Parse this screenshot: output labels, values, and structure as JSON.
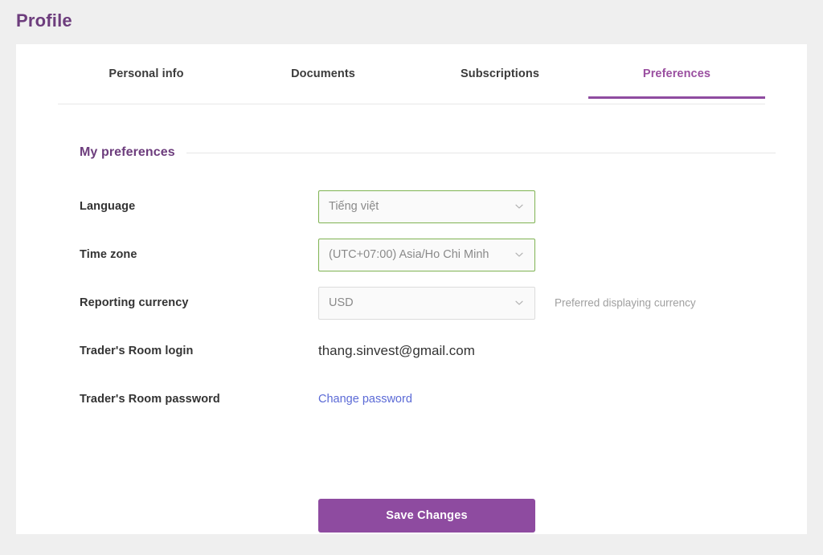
{
  "page": {
    "title": "Profile"
  },
  "tabs": [
    {
      "label": "Personal info",
      "active": false
    },
    {
      "label": "Documents",
      "active": false
    },
    {
      "label": "Subscriptions",
      "active": false
    },
    {
      "label": "Preferences",
      "active": true
    }
  ],
  "section": {
    "title": "My preferences"
  },
  "form": {
    "language": {
      "label": "Language",
      "value": "Tiếng việt",
      "state": "valid",
      "icon": "chevron-down-icon"
    },
    "timezone": {
      "label": "Time zone",
      "value": "(UTC+07:00) Asia/Ho Chi Minh",
      "state": "valid",
      "icon": "chevron-down-icon"
    },
    "currency": {
      "label": "Reporting currency",
      "value": "USD",
      "state": "default",
      "hint": "Preferred displaying currency",
      "icon": "chevron-down-icon"
    },
    "login": {
      "label": "Trader's Room login",
      "value": "thang.sinvest@gmail.com"
    },
    "password": {
      "label": "Trader's Room password",
      "action_label": "Change password"
    }
  },
  "actions": {
    "save_label": "Save Changes"
  },
  "colors": {
    "brand_purple": "#8e4ba0",
    "title_purple": "#6d3d7d",
    "active_tab_purple": "#9a4fa0",
    "valid_green": "#7fb352",
    "link_blue": "#5b6ad6",
    "page_bg": "#efefef",
    "card_bg": "#ffffff"
  }
}
